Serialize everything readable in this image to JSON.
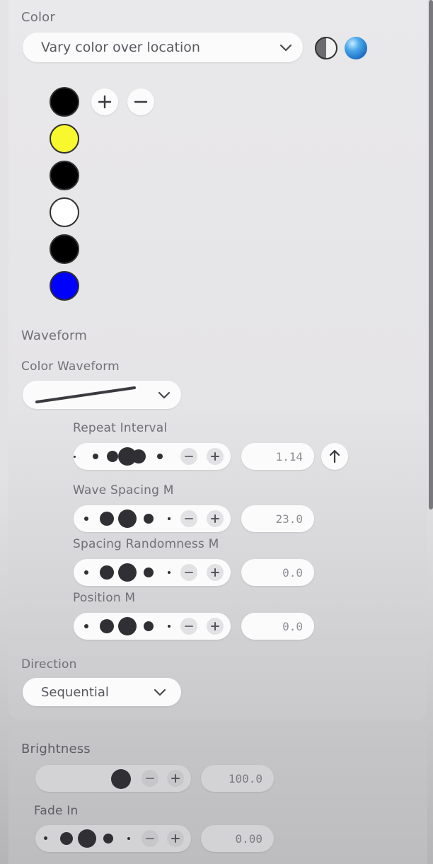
{
  "color": {
    "section_label": "Color",
    "mode_value": "Vary color over location",
    "swatches": [
      "#000000",
      "#f8f82e",
      "#000000",
      "#ffffff",
      "#000000",
      "#0000ff"
    ],
    "add_icon": "plus-icon",
    "remove_icon": "minus-icon"
  },
  "waveform": {
    "section_label": "Waveform",
    "color_waveform_label": "Color Waveform",
    "repeat_interval": {
      "label": "Repeat Interval",
      "value": "1.14"
    },
    "wave_spacing": {
      "label": "Wave Spacing M",
      "value": "23.0"
    },
    "spacing_randomness": {
      "label": "Spacing Randomness M",
      "value": "0.0"
    },
    "position": {
      "label": "Position M",
      "value": "0.0"
    }
  },
  "direction": {
    "label": "Direction",
    "value": "Sequential"
  },
  "brightness": {
    "label": "Brightness",
    "value": "100.0",
    "fade_in": {
      "label": "Fade In",
      "value": "0.00"
    }
  }
}
